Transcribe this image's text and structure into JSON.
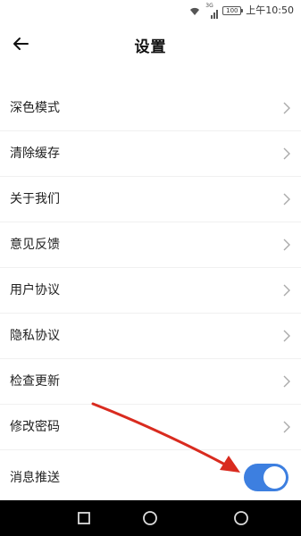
{
  "status_bar": {
    "network_label": "3G",
    "battery_label": "100",
    "time": "上午10:50"
  },
  "header": {
    "title": "设置",
    "back_icon": "arrow-left-icon"
  },
  "menu": {
    "items": [
      {
        "label": "深色模式"
      },
      {
        "label": "清除缓存"
      },
      {
        "label": "关于我们"
      },
      {
        "label": "意见反馈"
      },
      {
        "label": "用户协议"
      },
      {
        "label": "隐私协议"
      },
      {
        "label": "检查更新"
      },
      {
        "label": "修改密码"
      }
    ],
    "chevron_icon": "chevron-right-icon"
  },
  "push": {
    "label": "消息推送",
    "enabled": true,
    "accent_color": "#3d7fe0"
  },
  "annotation": {
    "arrow_color": "#d92b1f"
  },
  "nav_bar": {
    "icons": [
      "square-icon",
      "circle-home-icon",
      "circle-back-icon"
    ]
  }
}
